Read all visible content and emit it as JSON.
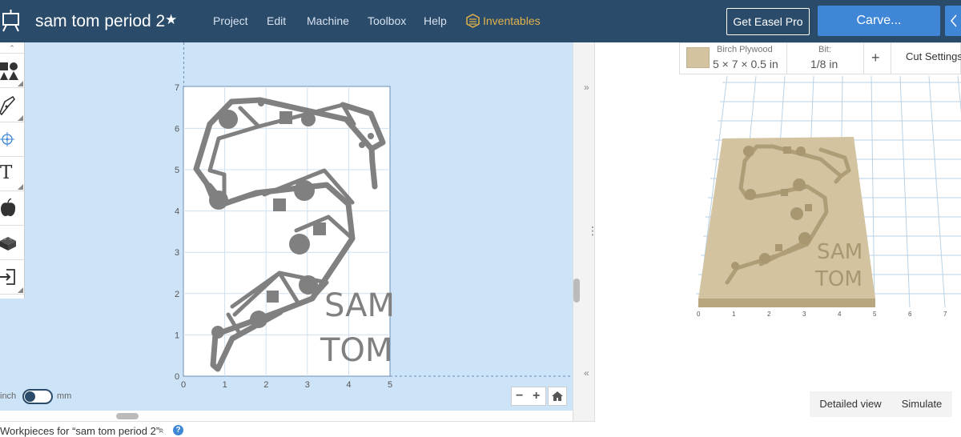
{
  "header": {
    "title": "sam tom period 2",
    "favorite_glyph": "★",
    "menu": [
      "Project",
      "Edit",
      "Machine",
      "Toolbox",
      "Help"
    ],
    "inventables_label": "Inventables",
    "get_pro_label": "Get Easel Pro",
    "carve_label": "Carve..."
  },
  "toolbar": {
    "tools": [
      "shapes-icon",
      "pen-icon",
      "target-icon",
      "text-icon",
      "apple-icon",
      "lego-brick-icon",
      "import-icon"
    ],
    "text_glyph": "T"
  },
  "canvas": {
    "y_ticks": [
      "0",
      "1",
      "2",
      "3",
      "4",
      "5",
      "6",
      "7"
    ],
    "x_ticks": [
      "0",
      "1",
      "2",
      "3",
      "4",
      "5"
    ],
    "design_text_line1": "SAM",
    "design_text_line2": "TOM"
  },
  "units": {
    "inch": "inch",
    "mm": "mm"
  },
  "zoom": {
    "minus": "−",
    "plus": "+"
  },
  "workpieces": {
    "label": "Workpieces for “sam tom period 2”",
    "chevron": "»",
    "help": "?"
  },
  "material": {
    "name": "Birch Plywood",
    "dims": "5 × 7 × 0.5 in",
    "bit_label": "Bit:",
    "bit_value": "1/8 in",
    "plus": "+",
    "cut_settings": "Cut Settings"
  },
  "preview": {
    "x_ticks": [
      "0",
      "1",
      "2",
      "3",
      "4",
      "5",
      "6",
      "7"
    ],
    "text_line1": "SAM",
    "text_line2": "TOM"
  },
  "view": {
    "detailed_label": "Detailed view",
    "simulate_label": "Simulate"
  },
  "colors": {
    "header": "#2b4b6b",
    "accent": "#3f87d6",
    "inventables": "#e2b24a",
    "canvas_bg": "#cde3f7",
    "wood": "#d3c3a0"
  }
}
